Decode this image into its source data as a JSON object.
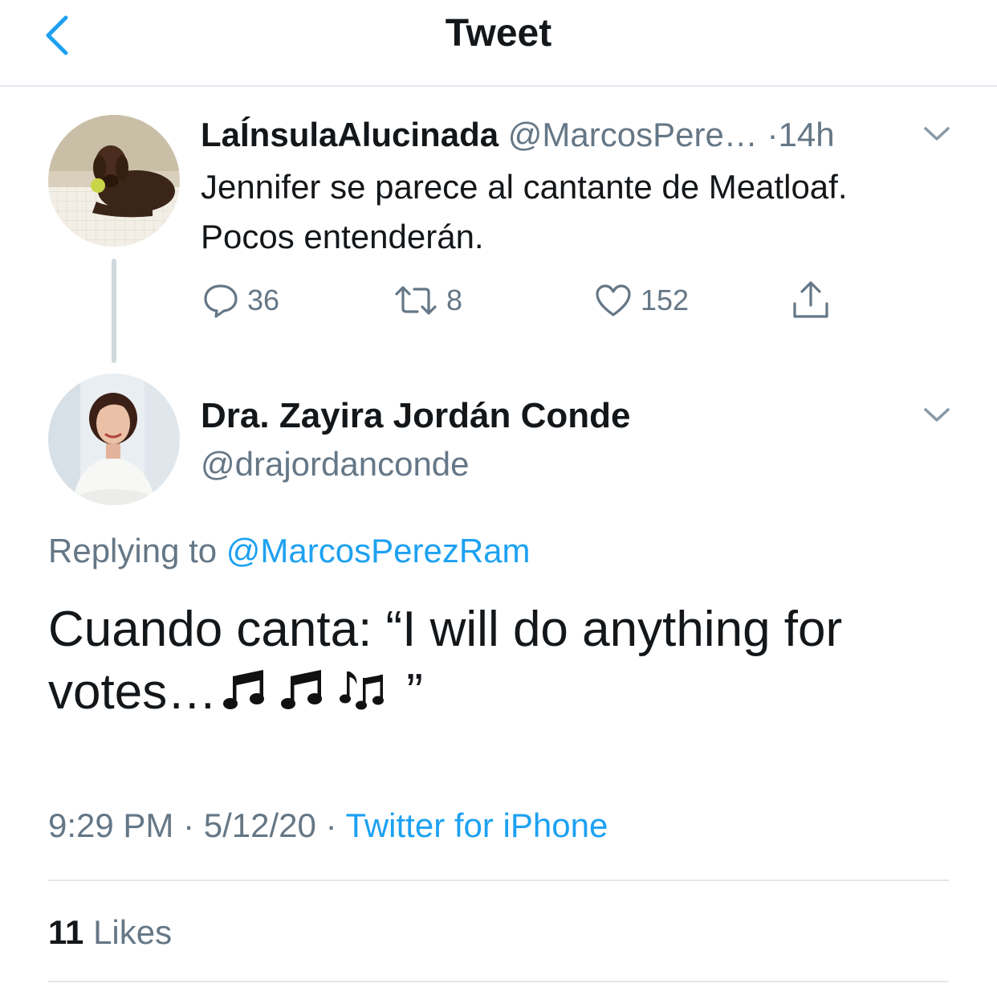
{
  "header": {
    "title": "Tweet"
  },
  "parent_tweet": {
    "display_name": "LaÍnsulaAlucinada",
    "handle": "@MarcosPere…",
    "separator": "·",
    "time": "14h",
    "text": "Jennifer se parece al cantante de Meatloaf. Pocos entenderán.",
    "actions": {
      "replies": "36",
      "retweets": "8",
      "likes": "152"
    }
  },
  "main_tweet": {
    "display_name": "Dra. Zayira Jordán Conde",
    "handle": "@drajordanconde",
    "replying_prefix": "Replying to",
    "replying_handle": "@MarcosPerezRam",
    "text": "Cuando canta: “I will do anything for votes…",
    "text_end": "”",
    "time": "9:29 PM",
    "sep1": "·",
    "date": "5/12/20",
    "sep2": "·",
    "source": "Twitter for iPhone",
    "likes_count": "11",
    "likes_label": "Likes"
  },
  "colors": {
    "accent": "#1da1f2",
    "muted": "#657786",
    "text": "#14171a",
    "divider": "#e1e8ed"
  },
  "icons": [
    "chevron-left-icon",
    "chevron-down-icon",
    "reply-icon",
    "retweet-icon",
    "heart-icon",
    "share-icon",
    "music-notes-icon"
  ]
}
